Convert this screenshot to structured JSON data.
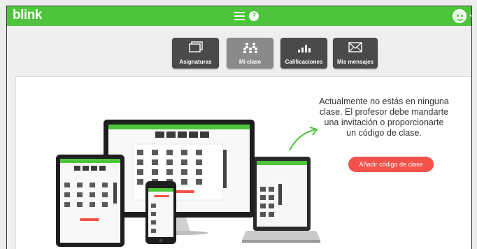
{
  "topbar": {
    "brand": "blink",
    "menu_icon": "hamburger-icon",
    "help_icon": "help-icon",
    "help_glyph": "?",
    "avatar_icon": "smiley-avatar-icon",
    "color": "#4ec43c"
  },
  "nav": {
    "items": [
      {
        "label": "Asignaturas",
        "icon": "screens-icon",
        "active": false
      },
      {
        "label": "Mi clase",
        "icon": "people-icon",
        "active": true
      },
      {
        "label": "Calificaciones",
        "icon": "bars-icon",
        "active": false
      },
      {
        "label": "Mis mensajes",
        "icon": "envelope-icon",
        "active": false
      }
    ]
  },
  "main": {
    "message": "Actualmente no estás en ninguna clase. El profesor debe mandarte una invitación o proporcionarte un código de clase.",
    "cta_label": "Añadir código de clase",
    "cta_color": "#f2524a",
    "illustration": "devices-illustration"
  }
}
